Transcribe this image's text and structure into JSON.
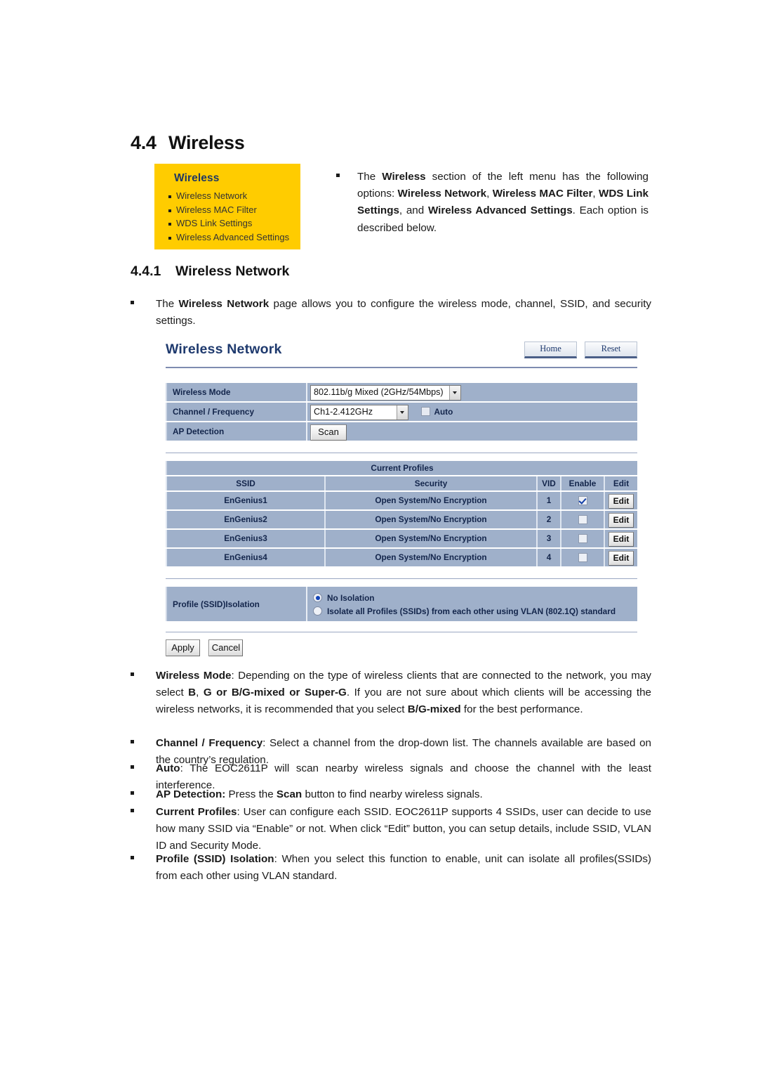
{
  "document": {
    "section": {
      "number": "4.4",
      "title": "Wireless"
    },
    "subsection": {
      "number": "4.4.1",
      "title": "Wireless Network"
    }
  },
  "callout": {
    "title": "Wireless",
    "items": [
      "Wireless Network",
      "Wireless MAC Filter",
      "WDS Link Settings",
      "Wireless Advanced Settings"
    ]
  },
  "bullets": {
    "intro": "The <b>Wireless</b> section of the left menu has the following options: <b>Wireless Network</b>, <b>Wireless MAC Filter</b>, <b>WDS Link Settings</b>, and <b>Wireless Advanced Settings</b>. Each option is described below.",
    "wireless_network": "The <b>Wireless Network</b> page allows you to configure the wireless mode, channel, SSID, and security settings.",
    "wireless_mode": "<b>Wireless Mode</b>: Depending on the type of wireless clients that are connected to the network, you may select <b>B</b>, <b>G or B/G-mixed or Super-G</b>. If you are not sure about which clients will be accessing the wireless networks, it is recommended that you select <b>B/G-mixed</b> for the best performance.",
    "channel_frequency": "<b>Channel / Frequency</b>: Select a channel from the drop-down list. The channels available are based on the country’s regulation.",
    "auto": "<b>Auto</b>: The EOC2611P will scan nearby wireless signals and choose the channel with the least interference.",
    "ap_detection": "<b>AP Detection:</b> Press the <b>Scan</b> button to find nearby wireless signals.",
    "current_profiles": "<b>Current Profiles</b>: User can configure each SSID. EOC2611P supports 4 SSIDs, user can decide to use how many SSID via “Enable” or not. When click “Edit” button, you can setup details, include SSID, VLAN ID and Security Mode.",
    "profile_isolation": "<b>Profile (SSID) Isolation</b>: When you select this function to enable, unit can isolate all profiles(SSIDs) from each other using VLAN standard."
  },
  "ui": {
    "title": "Wireless Network",
    "buttons": {
      "home": "Home",
      "reset": "Reset"
    },
    "form": {
      "wireless_mode": {
        "label": "Wireless Mode",
        "value": "802.11b/g Mixed (2GHz/54Mbps)"
      },
      "channel_frequency": {
        "label": "Channel / Frequency",
        "value": "Ch1-2.412GHz",
        "auto_label": "Auto",
        "auto_checked": false
      },
      "ap_detection": {
        "label": "AP Detection",
        "scan_label": "Scan"
      }
    },
    "profiles": {
      "caption": "Current Profiles",
      "columns": [
        "SSID",
        "Security",
        "VID",
        "Enable",
        "Edit"
      ],
      "edit_label": "Edit",
      "rows": [
        {
          "ssid": "EnGenius1",
          "security": "Open System/No Encryption",
          "vid": "1",
          "enabled": true
        },
        {
          "ssid": "EnGenius2",
          "security": "Open System/No Encryption",
          "vid": "2",
          "enabled": false
        },
        {
          "ssid": "EnGenius3",
          "security": "Open System/No Encryption",
          "vid": "3",
          "enabled": false
        },
        {
          "ssid": "EnGenius4",
          "security": "Open System/No Encryption",
          "vid": "4",
          "enabled": false
        }
      ]
    },
    "isolation": {
      "label": "Profile (SSID)Isolation",
      "options": [
        {
          "label": "No Isolation",
          "selected": true
        },
        {
          "label": "Isolate all Profiles (SSIDs) from each other using VLAN (802.1Q) standard",
          "selected": false
        }
      ]
    },
    "footer": {
      "apply": "Apply",
      "cancel": "Cancel"
    }
  },
  "colors": {
    "callout_bg": "#FFCC00",
    "callout_title": "#1F3864",
    "ui_title": "#1F3A6E",
    "panel_bg": "#9FB0CA",
    "panel_text": "#13254B",
    "rule": "#7E8CB0"
  }
}
